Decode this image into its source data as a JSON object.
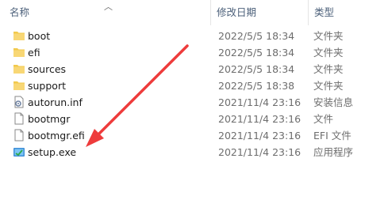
{
  "columns": {
    "name": "名称",
    "date": "修改日期",
    "type": "类型"
  },
  "files": [
    {
      "name": "boot",
      "date": "2022/5/5 18:34",
      "type": "文件夹",
      "icon": "folder-icon"
    },
    {
      "name": "efi",
      "date": "2022/5/5 18:34",
      "type": "文件夹",
      "icon": "folder-icon"
    },
    {
      "name": "sources",
      "date": "2022/5/5 18:34",
      "type": "文件夹",
      "icon": "folder-icon"
    },
    {
      "name": "support",
      "date": "2022/5/5 18:38",
      "type": "文件夹",
      "icon": "folder-icon"
    },
    {
      "name": "autorun.inf",
      "date": "2021/11/4 23:16",
      "type": "安装信息",
      "icon": "setup-info-icon"
    },
    {
      "name": "bootmgr",
      "date": "2021/11/4 23:16",
      "type": "文件",
      "icon": "file-icon"
    },
    {
      "name": "bootmgr.efi",
      "date": "2021/11/4 23:16",
      "type": "EFI 文件",
      "icon": "file-icon"
    },
    {
      "name": "setup.exe",
      "date": "2021/11/4 23:16",
      "type": "应用程序",
      "icon": "setup-exe-icon"
    }
  ],
  "annotation": {
    "color": "#ee3b3b",
    "points_to": "setup.exe"
  },
  "colors": {
    "folder": "#f8d775",
    "header_text": "#4c607a",
    "meta_text": "#6d6d6d"
  }
}
